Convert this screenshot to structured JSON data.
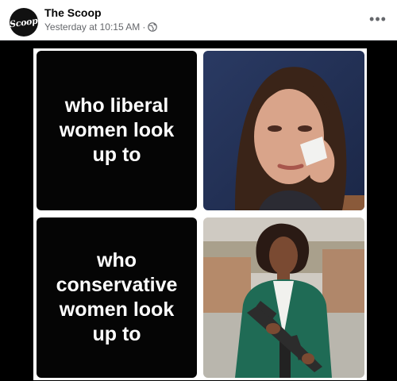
{
  "post": {
    "page_name": "The Scoop",
    "timestamp": "Yesterday at 10:15 AM",
    "separator": "·",
    "avatar_text": "Scoop",
    "more_label": "•••"
  },
  "meme": {
    "top_caption": "who liberal\nwomen look\nup to",
    "bottom_caption": "who\nconservative\nwomen look\nup to"
  },
  "icons": {
    "privacy": "globe-icon",
    "more": "more-horizontal-icon"
  },
  "colors": {
    "header_bg": "#ffffff",
    "secondary_text": "#65676b",
    "image_bg": "#000000",
    "panel_bg": "#050505"
  }
}
